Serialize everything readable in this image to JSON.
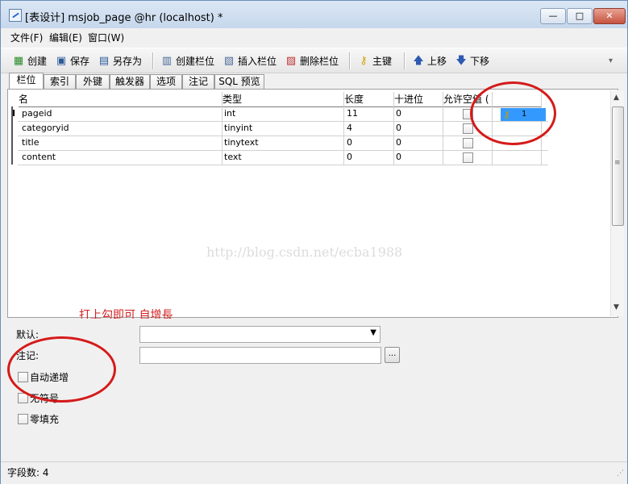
{
  "window": {
    "title": "[表设计] msjob_page @hr (localhost) *",
    "min_symbol": "—",
    "max_symbol": "□",
    "close_symbol": "✕"
  },
  "menu": [
    "文件(F)",
    "编辑(E)",
    "窗口(W)"
  ],
  "toolbar": {
    "create": "创建",
    "save": "保存",
    "save_as": "另存为",
    "create_field": "创建栏位",
    "insert_field": "插入栏位",
    "delete_field": "删除栏位",
    "primary_key": "主键",
    "move_up": "上移",
    "move_down": "下移"
  },
  "tabs": [
    "栏位",
    "索引",
    "外键",
    "触发器",
    "选项",
    "注记",
    "SQL 预览"
  ],
  "grid": {
    "headers": [
      "名",
      "类型",
      "长度",
      "十进位",
      "允许空值 (",
      ""
    ],
    "rows": [
      {
        "name": "pageid",
        "type": "int",
        "length": "11",
        "decimals": "0",
        "allow_null": false,
        "key": "1"
      },
      {
        "name": "categoryid",
        "type": "tinyint",
        "length": "4",
        "decimals": "0",
        "allow_null": false,
        "key": ""
      },
      {
        "name": "title",
        "type": "tinytext",
        "length": "0",
        "decimals": "0",
        "allow_null": false,
        "key": ""
      },
      {
        "name": "content",
        "type": "text",
        "length": "0",
        "decimals": "0",
        "allow_null": false,
        "key": ""
      }
    ],
    "current_row_marker": "I",
    "watermark": "http://blog.csdn.net/ecba1988"
  },
  "annotation": "打上勾即可 自增長",
  "properties": {
    "default_label": "默认:",
    "default_value": "",
    "comment_label": "注记:",
    "comment_value": "",
    "ellipsis": "...",
    "auto_increment_label": "自动递增",
    "auto_increment": false,
    "unsigned_label": "无符号",
    "unsigned": false,
    "zerofill_label": "零填充",
    "zerofill": false
  },
  "status": "字段数: 4",
  "colors": {
    "annotation_red": "#d51a1a",
    "selection_blue": "#3399ff"
  }
}
